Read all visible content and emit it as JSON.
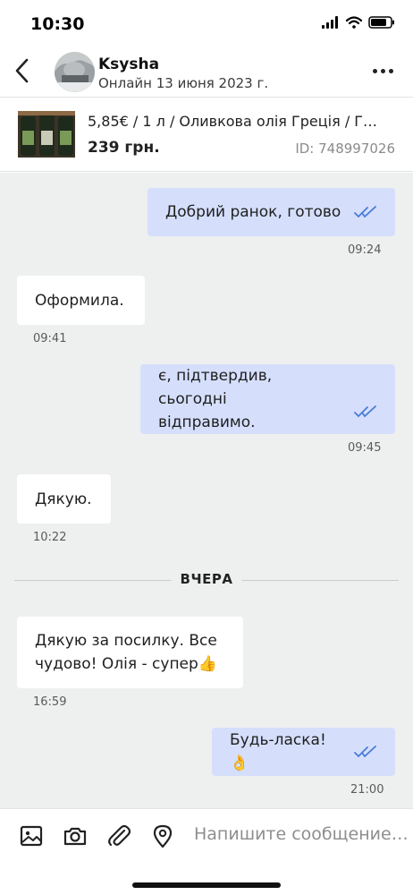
{
  "status_bar": {
    "time": "10:30"
  },
  "header": {
    "name": "Ksysha",
    "status": "Онлайн 13 июня 2023 г."
  },
  "product": {
    "title": "5,85€ / 1 л / Оливкова олія Греція / Г…",
    "price": "239 грн.",
    "id": "ID: 748997026"
  },
  "messages": [
    {
      "direction": "out",
      "lines": [
        "Добрий ранок, готово"
      ],
      "time": "09:24",
      "read": true
    },
    {
      "direction": "in",
      "lines": [
        "Оформила."
      ],
      "time": "09:41"
    },
    {
      "direction": "out",
      "lines": [
        "є, підтвердив, сьогодні",
        "відправимо."
      ],
      "time": "09:45",
      "read": true
    },
    {
      "direction": "in",
      "lines": [
        "Дякую."
      ],
      "time": "10:22"
    },
    {
      "direction": "in",
      "lines": [
        "Дякую за посилку. Все",
        "чудово! Олія - супер👍"
      ],
      "time": "16:59"
    },
    {
      "direction": "out",
      "lines": [
        "Будь-ласка! 👌"
      ],
      "time": "21:00",
      "read": true
    }
  ],
  "day_separator": "ВЧЕРА",
  "composer": {
    "placeholder": "Напишите сообщение…",
    "icons": [
      "image-icon",
      "camera-icon",
      "attach-icon",
      "location-icon"
    ]
  },
  "colors": {
    "outgoing_bubble": "#d5dffc",
    "incoming_bubble": "#ffffff",
    "chat_background": "#eef0f0",
    "read_check": "#4a7bd8"
  }
}
